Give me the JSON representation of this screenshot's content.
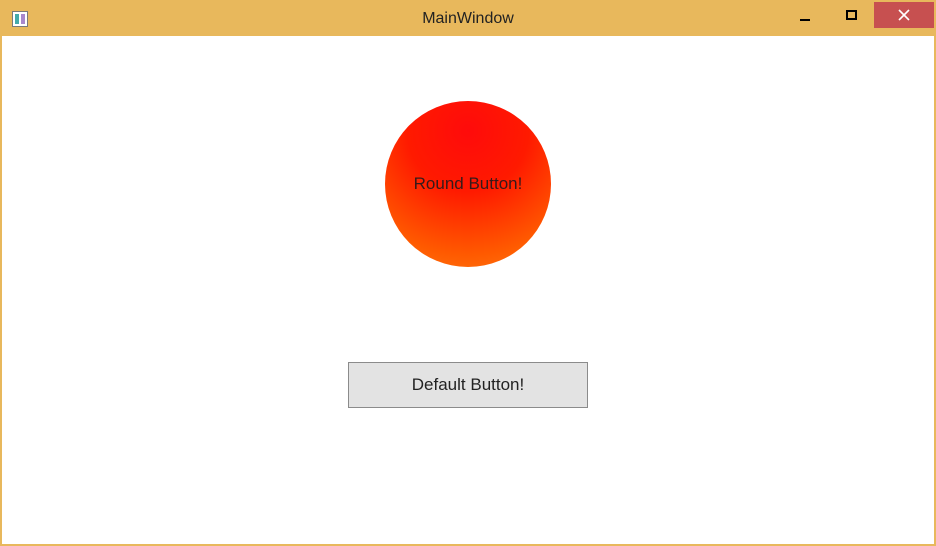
{
  "window": {
    "title": "MainWindow"
  },
  "buttons": {
    "round_label": "Round Button!",
    "default_label": "Default Button!"
  },
  "colors": {
    "chrome": "#e8b85c",
    "close": "#c75050",
    "round_gradient_top": "#ff0b0b",
    "round_gradient_bottom": "#ff7a12"
  }
}
